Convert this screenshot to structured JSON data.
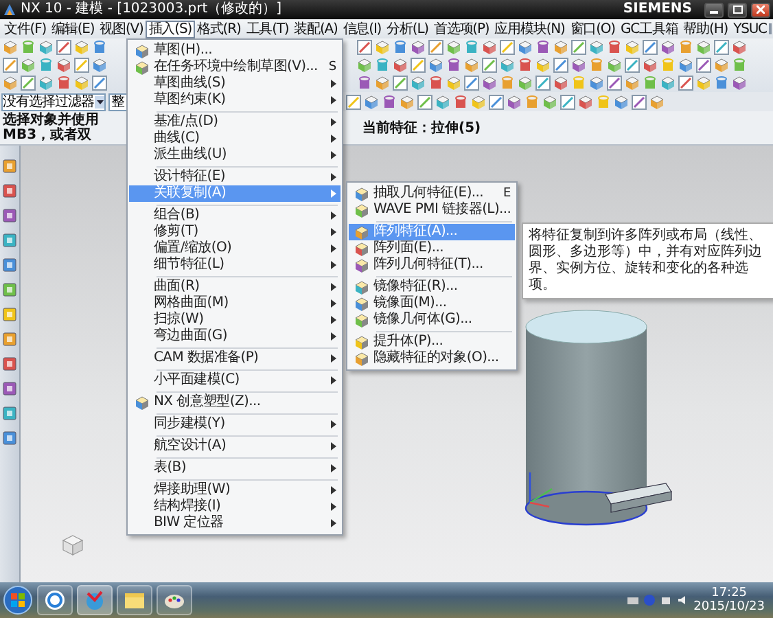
{
  "window": {
    "title": "NX 10 - 建模 - [1023003.prt（修改的）]",
    "brand": "SIEMENS"
  },
  "menu_bar": [
    {
      "label": "文件(F)",
      "selected": false
    },
    {
      "label": "编辑(E)",
      "selected": false
    },
    {
      "label": "视图(V)",
      "selected": false
    },
    {
      "label": "插入(S)",
      "selected": true
    },
    {
      "label": "格式(R)",
      "selected": false
    },
    {
      "label": "工具(T)",
      "selected": false
    },
    {
      "label": "装配(A)",
      "selected": false
    },
    {
      "label": "信息(I)",
      "selected": false
    },
    {
      "label": "分析(L)",
      "selected": false
    },
    {
      "label": "首选项(P)",
      "selected": false
    },
    {
      "label": "应用模块(N)",
      "selected": false
    },
    {
      "label": "窗口(O)",
      "selected": false
    },
    {
      "label": "GC工具箱",
      "selected": false
    },
    {
      "label": "帮助(H)",
      "selected": false
    },
    {
      "label": "YSUC",
      "selected": false
    }
  ],
  "selection_bar": {
    "filter": "没有选择过滤器",
    "scope": "整"
  },
  "status": {
    "prompt": "选择对象并使用 MB3，或者双",
    "current_feature": "当前特征：拉伸(5)"
  },
  "insert_menu": {
    "groups": [
      [
        {
          "label": "草图(H)...",
          "icon": true,
          "submenu": false,
          "selected": false
        },
        {
          "label": "在任务环境中绘制草图(V)...",
          "icon": true,
          "shortcut": "S",
          "submenu": false,
          "selected": false
        },
        {
          "label": "草图曲线(S)",
          "icon": false,
          "submenu": true,
          "selected": false
        },
        {
          "label": "草图约束(K)",
          "icon": false,
          "submenu": true,
          "selected": false
        }
      ],
      [
        {
          "label": "基准/点(D)",
          "icon": false,
          "submenu": true,
          "selected": false
        },
        {
          "label": "曲线(C)",
          "icon": false,
          "submenu": true,
          "selected": false
        },
        {
          "label": "派生曲线(U)",
          "icon": false,
          "submenu": true,
          "selected": false
        }
      ],
      [
        {
          "label": "设计特征(E)",
          "icon": false,
          "submenu": true,
          "selected": false
        },
        {
          "label": "关联复制(A)",
          "icon": false,
          "submenu": true,
          "selected": true
        }
      ],
      [
        {
          "label": "组合(B)",
          "icon": false,
          "submenu": true,
          "selected": false
        },
        {
          "label": "修剪(T)",
          "icon": false,
          "submenu": true,
          "selected": false
        },
        {
          "label": "偏置/缩放(O)",
          "icon": false,
          "submenu": true,
          "selected": false
        },
        {
          "label": "细节特征(L)",
          "icon": false,
          "submenu": true,
          "selected": false
        }
      ],
      [
        {
          "label": "曲面(R)",
          "icon": false,
          "submenu": true,
          "selected": false
        },
        {
          "label": "网格曲面(M)",
          "icon": false,
          "submenu": true,
          "selected": false
        },
        {
          "label": "扫掠(W)",
          "icon": false,
          "submenu": true,
          "selected": false
        },
        {
          "label": "弯边曲面(G)",
          "icon": false,
          "submenu": true,
          "selected": false
        }
      ],
      [
        {
          "label": "CAM 数据准备(P)",
          "icon": false,
          "submenu": true,
          "selected": false
        }
      ],
      [
        {
          "label": "小平面建模(C)",
          "icon": false,
          "submenu": true,
          "selected": false
        }
      ],
      [
        {
          "label": "NX 创意塑型(Z)...",
          "icon": true,
          "submenu": false,
          "selected": false
        }
      ],
      [
        {
          "label": "同步建模(Y)",
          "icon": false,
          "submenu": true,
          "selected": false
        }
      ],
      [
        {
          "label": "航空设计(A)",
          "icon": false,
          "submenu": true,
          "selected": false
        }
      ],
      [
        {
          "label": "表(B)",
          "icon": false,
          "submenu": true,
          "selected": false
        }
      ],
      [
        {
          "label": "焊接助理(W)",
          "icon": false,
          "submenu": true,
          "selected": false
        },
        {
          "label": "结构焊接(I)",
          "icon": false,
          "submenu": true,
          "selected": false
        },
        {
          "label": "BIW 定位器",
          "icon": false,
          "submenu": true,
          "selected": false
        }
      ]
    ]
  },
  "copy_menu": {
    "groups": [
      [
        {
          "label": "抽取几何特征(E)...",
          "icon": true,
          "shortcut": "E",
          "submenu": false,
          "selected": false
        },
        {
          "label": "WAVE PMI 链接器(L)...",
          "icon": true,
          "submenu": false,
          "selected": false
        }
      ],
      [
        {
          "label": "阵列特征(A)...",
          "icon": true,
          "submenu": false,
          "selected": true
        },
        {
          "label": "阵列面(E)...",
          "icon": true,
          "submenu": false,
          "selected": false
        },
        {
          "label": "阵列几何特征(T)...",
          "icon": true,
          "submenu": false,
          "selected": false
        }
      ],
      [
        {
          "label": "镜像特征(R)...",
          "icon": true,
          "submenu": false,
          "selected": false
        },
        {
          "label": "镜像面(M)...",
          "icon": true,
          "submenu": false,
          "selected": false
        },
        {
          "label": "镜像几何体(G)...",
          "icon": true,
          "submenu": false,
          "selected": false
        }
      ],
      [
        {
          "label": "提升体(P)...",
          "icon": true,
          "submenu": false,
          "selected": false
        },
        {
          "label": "隐藏特征的对象(O)...",
          "icon": true,
          "submenu": false,
          "selected": false
        }
      ]
    ]
  },
  "tooltip": "将特征复制到许多阵列或布局（线性、圆形、多边形等）中，并有对应阵列边界、实例方位、旋转和变化的各种选项。",
  "taskbar": {
    "time": "17:25",
    "date": "2015/10/23"
  }
}
